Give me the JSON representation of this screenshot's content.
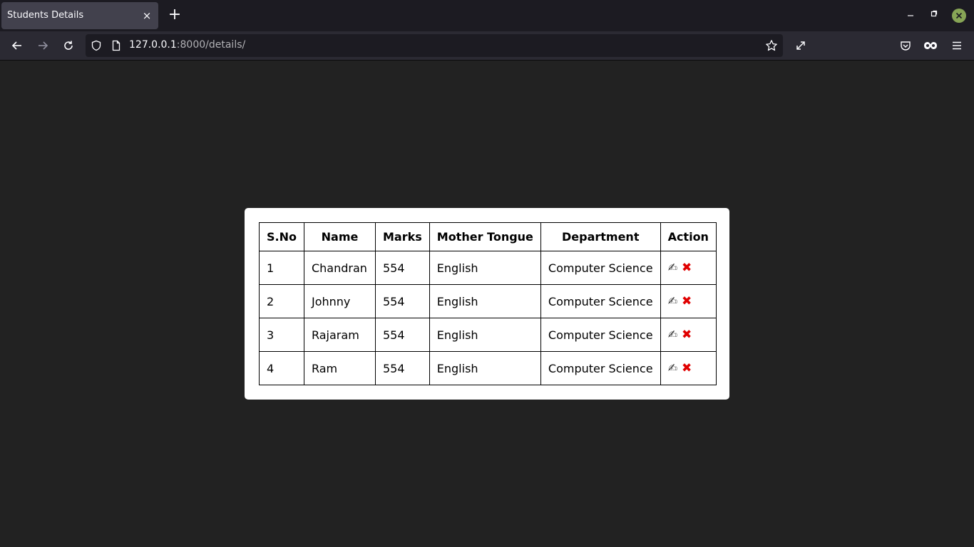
{
  "browser": {
    "tab_title": "Students Details",
    "tab_close": "×",
    "new_tab": "+",
    "url_host": "127.0.0.1",
    "url_rest": ":8000/details/"
  },
  "table": {
    "headers": [
      "S.No",
      "Name",
      "Marks",
      "Mother Tongue",
      "Department",
      "Action"
    ],
    "rows": [
      {
        "sno": "1",
        "name": "Chandran",
        "marks": "554",
        "tongue": "English",
        "dept": "Computer Science"
      },
      {
        "sno": "2",
        "name": "Johnny",
        "marks": "554",
        "tongue": "English",
        "dept": "Computer Science"
      },
      {
        "sno": "3",
        "name": "Rajaram",
        "marks": "554",
        "tongue": "English",
        "dept": "Computer Science"
      },
      {
        "sno": "4",
        "name": "Ram",
        "marks": "554",
        "tongue": "English",
        "dept": "Computer Science"
      }
    ],
    "edit_glyph": "✍",
    "delete_glyph": "✖"
  },
  "colors": {
    "page_bg": "#222222",
    "delete_red": "#e00000",
    "window_close": "#87a556"
  }
}
